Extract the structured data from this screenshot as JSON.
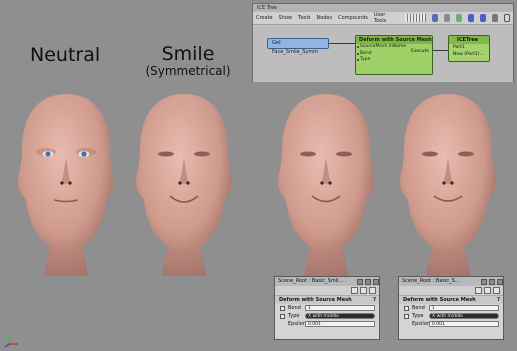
{
  "captions": {
    "neutral": "Neutral",
    "smile": "Smile",
    "smile_sub": "(Symmetrical)"
  },
  "ice_tree": {
    "title": "ICE Tree",
    "menu": [
      "Create",
      "Show",
      "Tools",
      "Nodes",
      "Compounds",
      "User Tools"
    ],
    "nodes": {
      "get": "Get Face_Smile_Symm",
      "deform": {
        "title": "Deform with Source Mesh",
        "ports": [
          "SourceMesh InName",
          "Bend",
          "Type"
        ],
        "output": "Execute"
      },
      "tree": {
        "title": "ICETree",
        "ports": [
          "Port1",
          "New (Port1)..."
        ]
      }
    },
    "icons": [
      "pin-icon",
      "lock-icon",
      "refresh-icon",
      "back-icon",
      "forward-icon",
      "home-icon",
      "help-icon"
    ]
  },
  "ppg_panels": [
    {
      "title": "Scene_Root : Basic_Smil...",
      "section": "Deform with Source Mesh",
      "rows": [
        {
          "label": "Bend",
          "value": "1"
        },
        {
          "label": "Type",
          "value": "X with middle"
        },
        {
          "label": "Epsilon",
          "value": "0.001"
        }
      ]
    },
    {
      "title": "Scene_Root : Basic_S...",
      "section": "Deform with Source Mesh",
      "rows": [
        {
          "label": "Bend",
          "value": "1"
        },
        {
          "label": "Type",
          "value": "X with middle"
        },
        {
          "label": "Epsilon",
          "value": "0.001"
        }
      ]
    }
  ],
  "colors": {
    "background": "#8f8f8f",
    "skin": "#d9a898",
    "skin_shadow": "#a7726a",
    "eye_blue": "#4a7fc0",
    "node_blue": "#8fb6e3",
    "node_green": "#9fd068"
  }
}
